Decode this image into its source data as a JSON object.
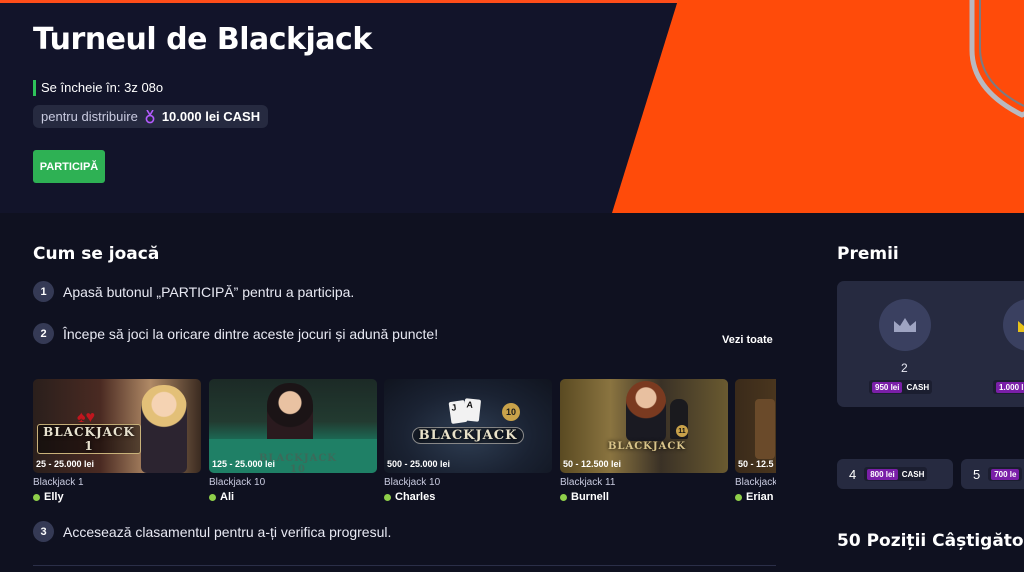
{
  "hero": {
    "title": "Turneul de Blackjack",
    "ends_in": "Se încheie în: 3z 08o",
    "prize_label": "pentru distribuire",
    "prize_amount": "10.000 lei CASH",
    "join_button": "PARTICIPĂ",
    "colors": {
      "accent": "#ff4b0a",
      "join": "#2eb154",
      "background": "#12142a"
    }
  },
  "how_to_play": {
    "title": "Cum se joacă",
    "steps": [
      {
        "num": "1",
        "text": "Apasă butonul „PARTICIPĂ” pentru a participa."
      },
      {
        "num": "2",
        "text": "Începe să joci la oricare dintre aceste jocuri și adună puncte!"
      },
      {
        "num": "3",
        "text": "Accesează clasamentul pentru a-ți verifica progresul."
      }
    ],
    "see_all": "Vezi toate",
    "games": [
      {
        "limits": "25 - 25.000 lei",
        "name": "Blackjack 1",
        "dealer": "Elly",
        "logo": "BLACKJACK 1"
      },
      {
        "limits": "125 - 25.000 lei",
        "name": "Blackjack 10",
        "dealer": "Ali",
        "logo": "BLACKJACK 10"
      },
      {
        "limits": "500 - 25.000 lei",
        "name": "Blackjack 10",
        "dealer": "Charles",
        "logo": "BLACKJACK"
      },
      {
        "limits": "50 - 12.500 lei",
        "name": "Blackjack 11",
        "dealer": "Burnell",
        "logo": "BLACKJACK"
      },
      {
        "limits": "50 - 12.5",
        "name": "Blackjack",
        "dealer": "Erian",
        "logo": ""
      }
    ]
  },
  "prizes": {
    "title": "Premii",
    "podium": [
      {
        "rank": "2",
        "amount": "950 lei",
        "currency": "CASH",
        "icon": "crown-icon"
      },
      {
        "rank": "",
        "amount": "1.000 l",
        "currency": "",
        "icon": "crown-icon"
      }
    ],
    "ranks": [
      {
        "num": "4",
        "amount": "800 lei",
        "currency": "CASH"
      },
      {
        "num": "5",
        "amount": "700 le",
        "currency": ""
      }
    ],
    "winners_title": "50 Poziții Câștigătoar"
  }
}
